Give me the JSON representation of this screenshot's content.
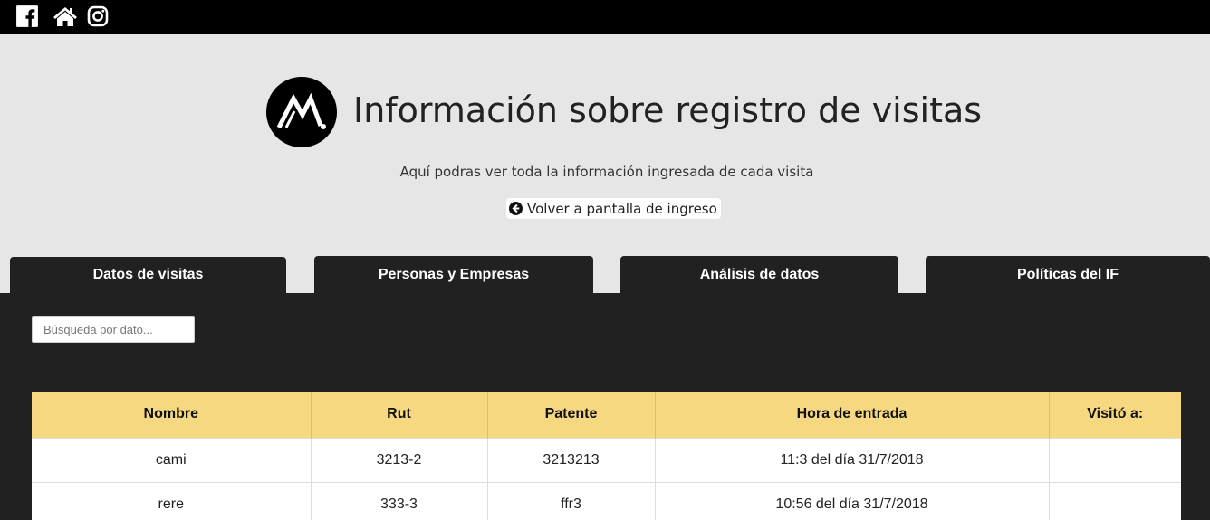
{
  "topbar": {
    "icons": [
      "facebook-icon",
      "home-icon",
      "instagram-icon"
    ]
  },
  "header": {
    "title": "Información sobre registro de visitas",
    "subtitle": "Aquí podras ver toda la información ingresada de cada visita",
    "back_label": "Volver a pantalla de ingreso"
  },
  "tabs": [
    {
      "label": "Datos de visitas"
    },
    {
      "label": "Personas y Empresas"
    },
    {
      "label": "Análisis de datos"
    },
    {
      "label": "Políticas del IF"
    }
  ],
  "search": {
    "placeholder": "Búsqueda por dato..."
  },
  "table": {
    "headers": [
      "Nombre",
      "Rut",
      "Patente",
      "Hora de entrada",
      "Visitó a:"
    ],
    "rows": [
      [
        "cami",
        "3213-2",
        "3213213",
        "11:3 del día 31/7/2018",
        ""
      ],
      [
        "rere",
        "333-3",
        "ffr3",
        "10:56 del día 31/7/2018",
        ""
      ]
    ]
  },
  "colors": {
    "topbar": "#000000",
    "background": "#e6e6e6",
    "panel": "#212121",
    "table_header": "#f5d880"
  }
}
